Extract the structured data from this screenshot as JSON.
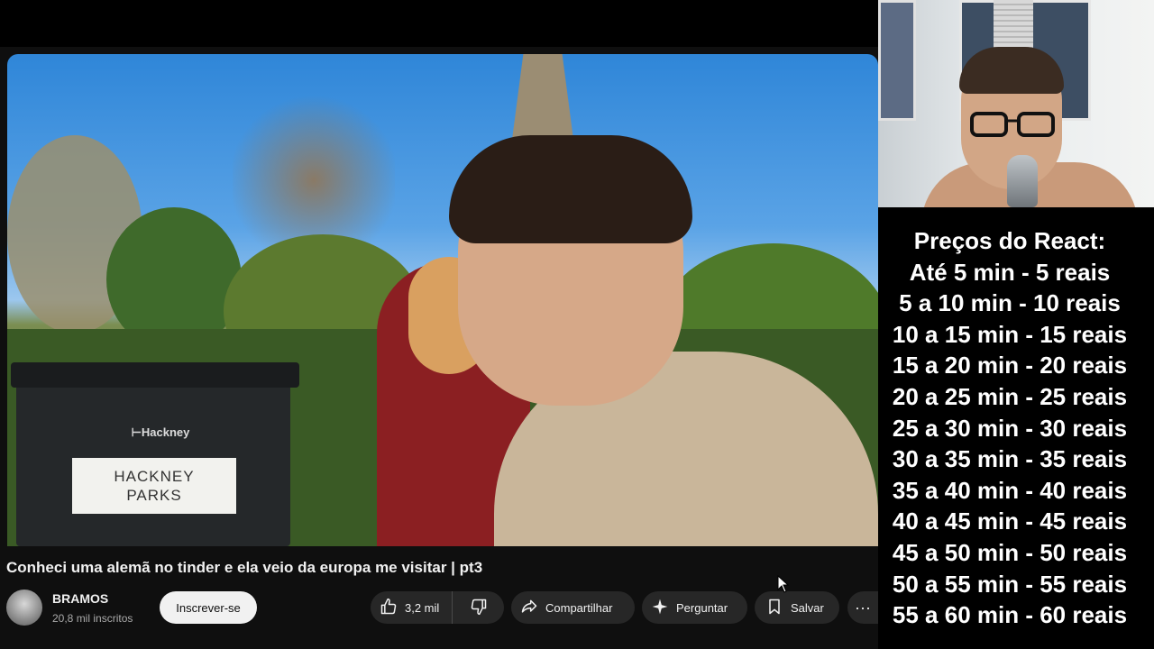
{
  "video": {
    "title": "Conheci uma alemã no tinder e ela veio da europa me visitar | pt3",
    "scene": {
      "bin_brand": "⊢Hackney",
      "bin_sign_line1": "HACKNEY",
      "bin_sign_line2": "PARKS"
    }
  },
  "channel": {
    "name": "BRAMOS",
    "subscribers": "20,8 mil inscritos",
    "subscribe_label": "Inscrever-se"
  },
  "actions": {
    "like_count": "3,2 mil",
    "share_label": "Compartilhar",
    "ask_label": "Perguntar",
    "save_label": "Salvar",
    "more_label": "···"
  },
  "icons": {
    "like": "thumbs-up-icon",
    "dislike": "thumbs-down-icon",
    "share": "share-arrow-icon",
    "ask": "sparkle-icon",
    "save": "bookmark-icon",
    "more": "more-horizontal-icon"
  },
  "price_list": {
    "title": "Preços do React:",
    "rows": [
      "Até 5 min - 5 reais",
      "5 a 10 min - 10 reais",
      "10 a 15 min - 15 reais",
      "15 a 20 min - 20 reais",
      "20 a 25 min - 25 reais",
      "25 a 30 min - 30 reais",
      "30 a 35 min - 35 reais",
      "35 a 40 min - 40 reais",
      "40 a 45 min - 45 reais",
      "45 a 50 min - 50 reais",
      "50 a 55 min - 55 reais",
      "55 a 60 min - 60 reais"
    ]
  },
  "colors": {
    "page_bg": "#0f0f0f",
    "pill_bg": "#272727",
    "subscribe_bg": "#f1f1f1",
    "text_primary": "#f1f1f1",
    "text_secondary": "#aaaaaa"
  }
}
